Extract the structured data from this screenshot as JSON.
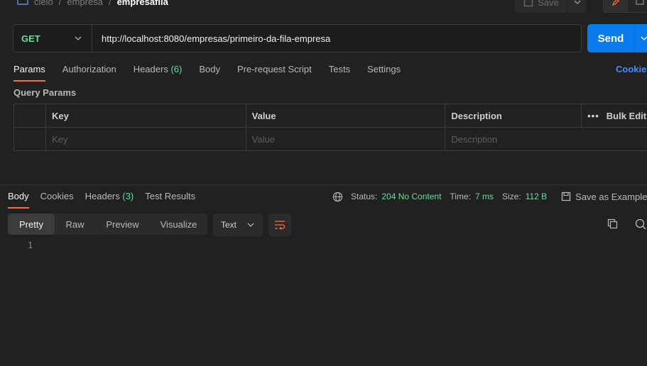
{
  "breadcrumb": {
    "items": [
      "cielo",
      "empresa"
    ],
    "current": "empresafila",
    "sep": "/"
  },
  "toolbar": {
    "save_label": "Save"
  },
  "request": {
    "method": "GET",
    "url": "http://localhost:8080/empresas/primeiro-da-fila-empresa",
    "send_label": "Send"
  },
  "request_tabs": [
    {
      "label": "Params",
      "active": true
    },
    {
      "label": "Authorization"
    },
    {
      "label": "Headers",
      "count": "(6)"
    },
    {
      "label": "Body"
    },
    {
      "label": "Pre-request Script"
    },
    {
      "label": "Tests"
    },
    {
      "label": "Settings"
    }
  ],
  "cookies_link": "Cookies",
  "query_params": {
    "title": "Query Params",
    "headers": {
      "key": "Key",
      "value": "Value",
      "description": "Description",
      "bulk_edit": "Bulk Edit"
    },
    "placeholders": {
      "key": "Key",
      "value": "Value",
      "description": "Description"
    }
  },
  "response_tabs": [
    {
      "label": "Body",
      "active": true
    },
    {
      "label": "Cookies"
    },
    {
      "label": "Headers",
      "count": "(3)"
    },
    {
      "label": "Test Results"
    }
  ],
  "status": {
    "status_label": "Status:",
    "status_value": "204 No Content",
    "time_label": "Time:",
    "time_value": "7 ms",
    "size_label": "Size:",
    "size_value": "112 B",
    "save_example": "Save as Example"
  },
  "view_modes": [
    "Pretty",
    "Raw",
    "Preview",
    "Visualize"
  ],
  "format": "Text",
  "line_number": "1",
  "colors": {
    "accent": "#ff6c37",
    "send": "#097bed",
    "green": "#6bdd9a",
    "link": "#3d8fff"
  }
}
